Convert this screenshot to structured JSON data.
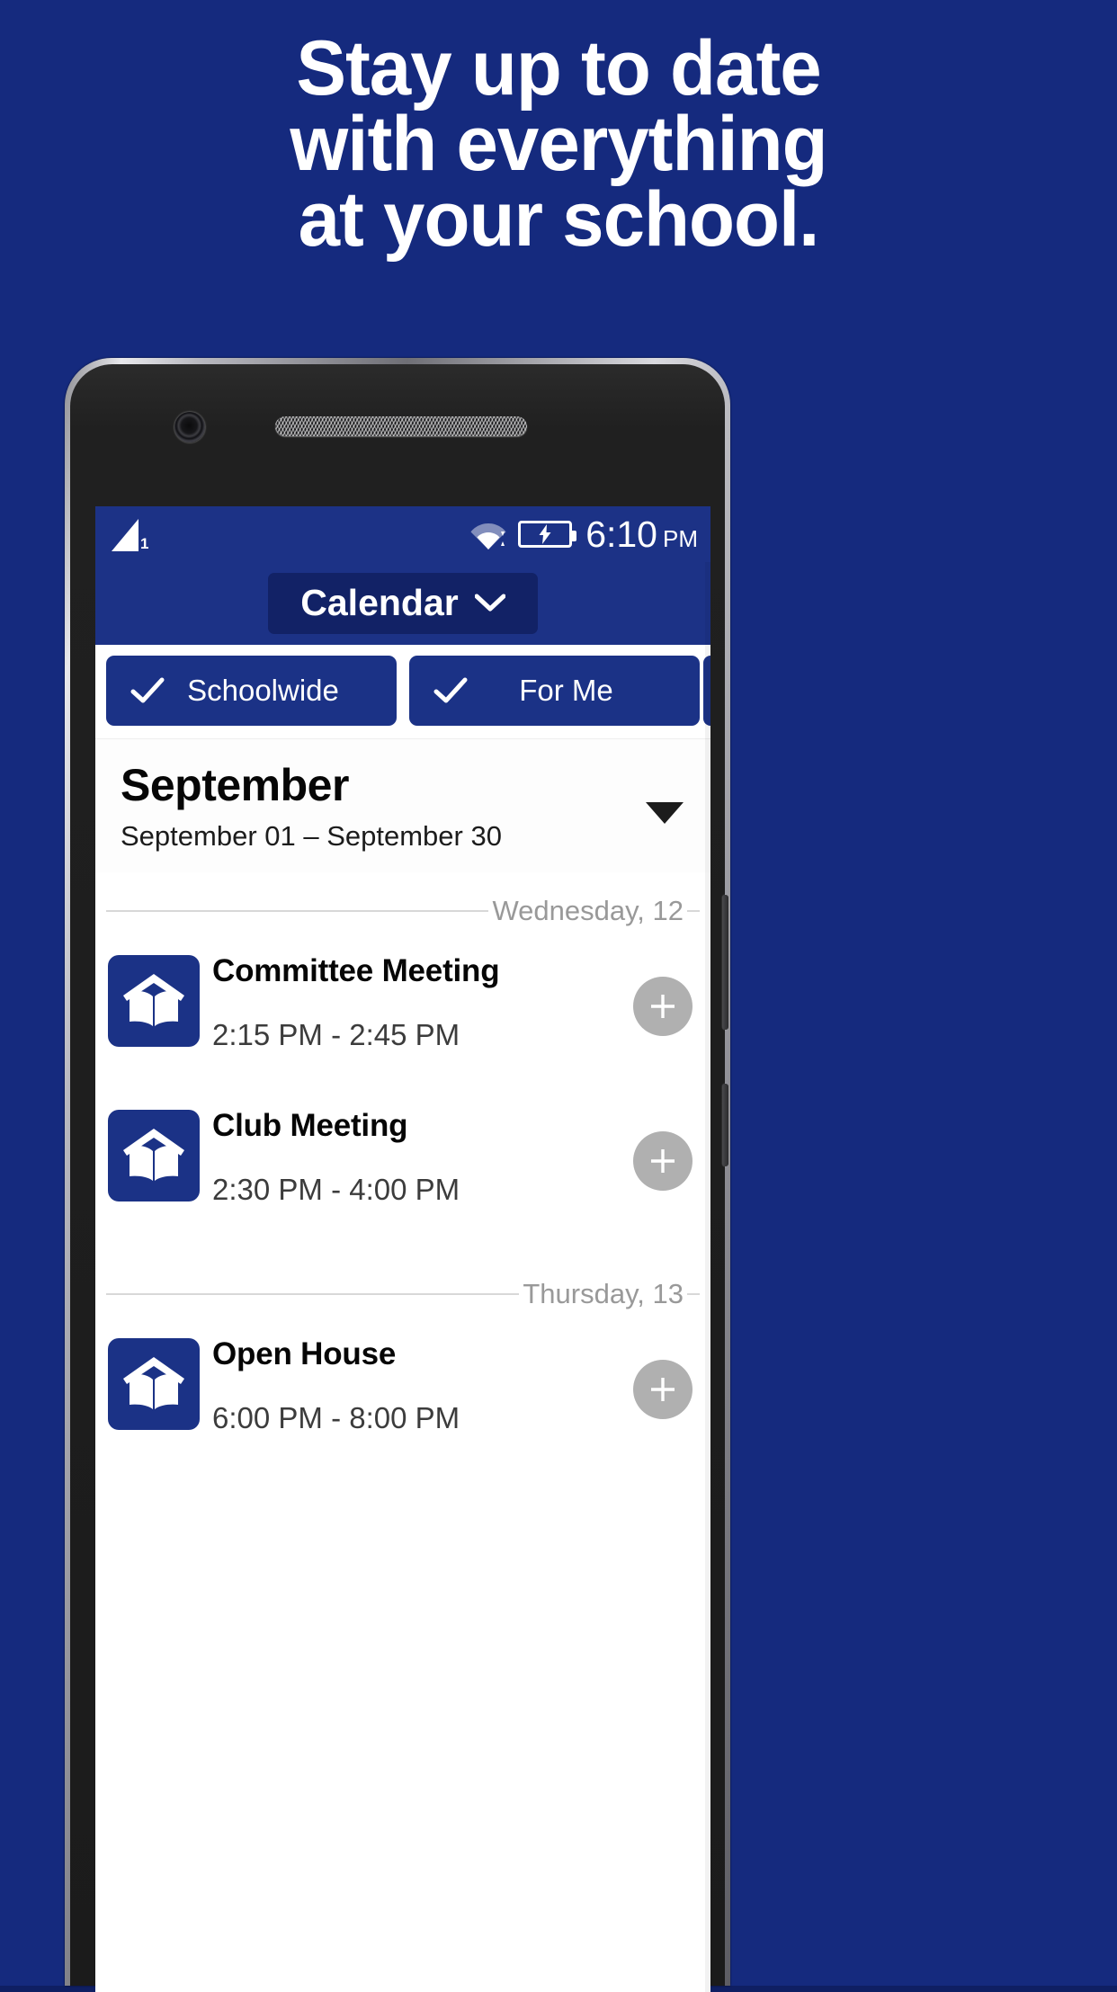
{
  "promo": {
    "background_color": "#152a7e",
    "headline_lines": [
      "Stay up to date",
      "with everything",
      "at your school."
    ],
    "headline_color": "#ffffff"
  },
  "phone": {
    "camera": "front-camera",
    "speaker": "earpiece-grille"
  },
  "status_bar": {
    "background_color": "#1c3286",
    "signal_icon": "signal-bars-icon",
    "signal_sub_label": "1",
    "wifi_icon": "wifi-icon",
    "battery_icon": "battery-charging-icon",
    "time": "6:10",
    "meridiem": "PM"
  },
  "app_bar": {
    "background_color": "#1c3286",
    "pill_color": "#122266",
    "title": "Calendar",
    "chevron_icon": "chevron-down-icon"
  },
  "filters": {
    "chip_color": "#1b3286",
    "chips": [
      {
        "label": "Schoolwide",
        "checked": true,
        "check_icon": "check-icon"
      },
      {
        "label": "For Me",
        "checked": true,
        "check_icon": "check-icon"
      }
    ]
  },
  "month_header": {
    "name": "September",
    "range": "September 01 – September 30",
    "caret_icon": "caret-down-icon"
  },
  "list": [
    {
      "type": "day_separator",
      "label": "Wednesday, 12"
    },
    {
      "type": "event",
      "icon": "school-book-icon",
      "title": "Committee Meeting",
      "time": "2:15 PM - 2:45 PM",
      "add_icon": "plus-icon"
    },
    {
      "type": "event",
      "icon": "school-book-icon",
      "title": "Club Meeting",
      "time": "2:30 PM - 4:00 PM",
      "add_icon": "plus-icon"
    },
    {
      "type": "day_separator",
      "label": "Thursday, 13"
    },
    {
      "type": "event",
      "icon": "school-book-icon",
      "title": "Open House",
      "time": "6:00 PM - 8:00 PM",
      "add_icon": "plus-icon"
    }
  ]
}
